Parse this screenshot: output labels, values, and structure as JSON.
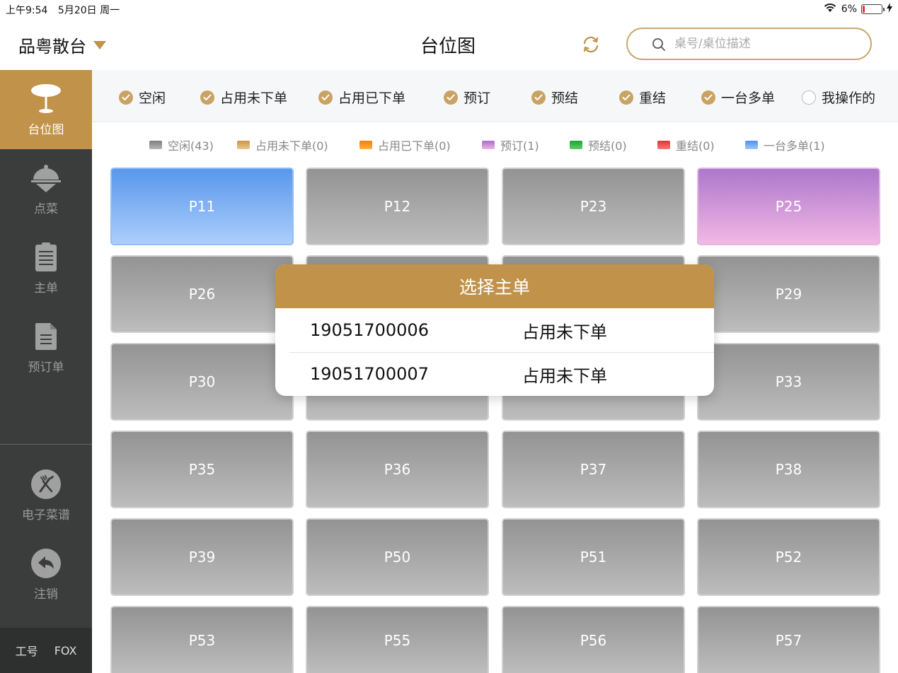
{
  "status_bar": {
    "time": "上午9:54",
    "date": "5月20日 周一",
    "battery": "6%"
  },
  "top": {
    "store": "品粤散台",
    "title": "台位图",
    "search_placeholder": "桌号/桌位描述"
  },
  "sidebar": {
    "items": [
      {
        "label": "台位图",
        "icon": "table-icon"
      },
      {
        "label": "点菜",
        "icon": "serving-cloche-icon"
      },
      {
        "label": "主单",
        "icon": "clipboard-icon"
      },
      {
        "label": "预订单",
        "icon": "document-icon"
      },
      {
        "label": "电子菜谱",
        "icon": "fork-knife-icon"
      },
      {
        "label": "注销",
        "icon": "back-arrow-icon"
      }
    ],
    "footer_label": "工号",
    "footer_value": "FOX"
  },
  "filters": [
    {
      "label": "空闲",
      "checked": true
    },
    {
      "label": "占用未下单",
      "checked": true
    },
    {
      "label": "占用已下单",
      "checked": true
    },
    {
      "label": "预订",
      "checked": true
    },
    {
      "label": "预结",
      "checked": true
    },
    {
      "label": "重结",
      "checked": true
    },
    {
      "label": "一台多单",
      "checked": true
    },
    {
      "label": "我操作的",
      "checked": false
    }
  ],
  "legend": [
    {
      "label": "空闲(43)",
      "color": "#9a9a9a"
    },
    {
      "label": "占用未下单(0)",
      "color": "#d6a766"
    },
    {
      "label": "占用已下单(0)",
      "color": "#f7931e"
    },
    {
      "label": "预订(1)",
      "color": "#c27fdc"
    },
    {
      "label": "预结(0)",
      "color": "#3bb54a"
    },
    {
      "label": "重结(0)",
      "color": "#ec4b4b"
    },
    {
      "label": "一台多单(1)",
      "color": "#4f91ec"
    }
  ],
  "tables": [
    {
      "name": "P11",
      "state": "multi"
    },
    {
      "name": "P12",
      "state": "idle"
    },
    {
      "name": "P23",
      "state": "idle"
    },
    {
      "name": "P25",
      "state": "reserved"
    },
    {
      "name": "P26",
      "state": "idle"
    },
    {
      "name": "",
      "state": "idle"
    },
    {
      "name": "",
      "state": "idle"
    },
    {
      "name": "P29",
      "state": "idle"
    },
    {
      "name": "P30",
      "state": "idle"
    },
    {
      "name": "",
      "state": "idle"
    },
    {
      "name": "",
      "state": "idle"
    },
    {
      "name": "P33",
      "state": "idle"
    },
    {
      "name": "P35",
      "state": "idle"
    },
    {
      "name": "P36",
      "state": "idle"
    },
    {
      "name": "P37",
      "state": "idle"
    },
    {
      "name": "P38",
      "state": "idle"
    },
    {
      "name": "P39",
      "state": "idle"
    },
    {
      "name": "P50",
      "state": "idle"
    },
    {
      "name": "P51",
      "state": "idle"
    },
    {
      "name": "P52",
      "state": "idle"
    },
    {
      "name": "P53",
      "state": "idle"
    },
    {
      "name": "P55",
      "state": "idle"
    },
    {
      "name": "P56",
      "state": "idle"
    },
    {
      "name": "P57",
      "state": "idle"
    }
  ],
  "dialog": {
    "title": "选择主单",
    "orders": [
      {
        "number": "19051700006",
        "status": "占用未下单"
      },
      {
        "number": "19051700007",
        "status": "占用未下单"
      }
    ]
  }
}
